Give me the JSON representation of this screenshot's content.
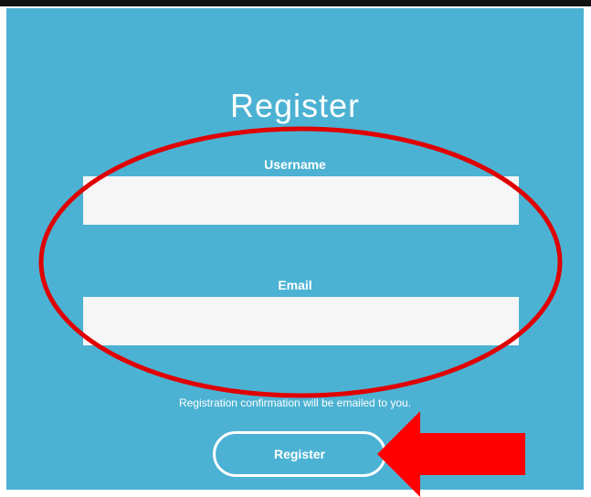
{
  "form": {
    "title": "Register",
    "username_label": "Username",
    "username_value": "",
    "email_label": "Email",
    "email_value": "",
    "confirmation_note": "Registration confirmation will be emailed to you.",
    "submit_label": "Register"
  },
  "annotations": {
    "ellipse": {
      "shape": "ellipse-outline",
      "color": "#e00000",
      "highlights": "username and email fields"
    },
    "arrow": {
      "shape": "arrow-pointing-left",
      "color": "#ff0000",
      "points_to": "register button"
    }
  },
  "colors": {
    "panel_background": "#4cb2d3",
    "text": "#ffffff",
    "field_background": "#f6f6f6",
    "annotation_red": "#ff0000"
  }
}
